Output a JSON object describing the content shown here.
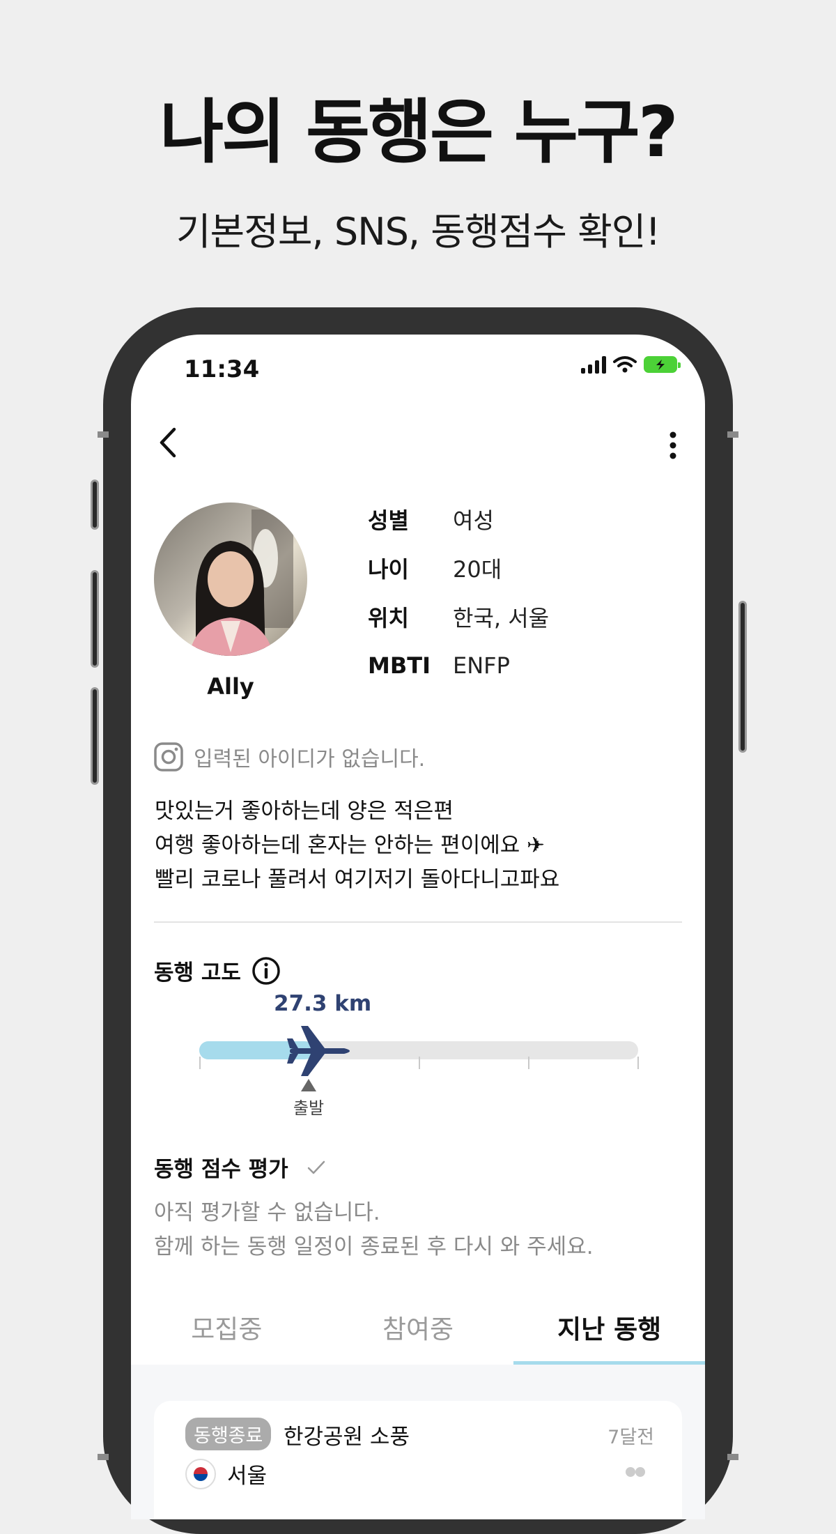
{
  "promo": {
    "title": "나의 동행은 누구?",
    "subtitle": "기본정보, SNS, 동행점수 확인!"
  },
  "status_bar": {
    "time": "11:34"
  },
  "profile": {
    "nickname": "Ally",
    "info": [
      {
        "label": "성별",
        "value": "여성"
      },
      {
        "label": "나이",
        "value": "20대"
      },
      {
        "label": "위치",
        "value": "한국, 서울"
      },
      {
        "label": "MBTI",
        "value": "ENFP"
      }
    ],
    "instagram_text": "입력된 아이디가 없습니다.",
    "bio": [
      "맛있는거 좋아하는데 양은 적은편",
      "여행 좋아하는데 혼자는 안하는 편이에요 ✈",
      "빨리 코로나 풀려서 여기저기 돌아다니고파요"
    ]
  },
  "altitude": {
    "title": "동행 고도",
    "value": "27.3 km",
    "start_label": "출발",
    "progress": 0.24
  },
  "score": {
    "title": "동행 점수 평가",
    "message": [
      "아직 평가할 수 없습니다.",
      "함께 하는 동행 일정이 종료된 후 다시 와 주세요."
    ]
  },
  "tabs": [
    {
      "label": "모집중",
      "active": false
    },
    {
      "label": "참여중",
      "active": false
    },
    {
      "label": "지난 동행",
      "active": true
    }
  ],
  "trip_card": {
    "badge": "동행종료",
    "title": "한강공원 소풍",
    "time_ago": "7달전",
    "location": "서울"
  },
  "colors": {
    "accent": "#a6dbec",
    "altitude_value": "#2f4272",
    "plane": "#2f4272",
    "battery": "#4cd137"
  }
}
